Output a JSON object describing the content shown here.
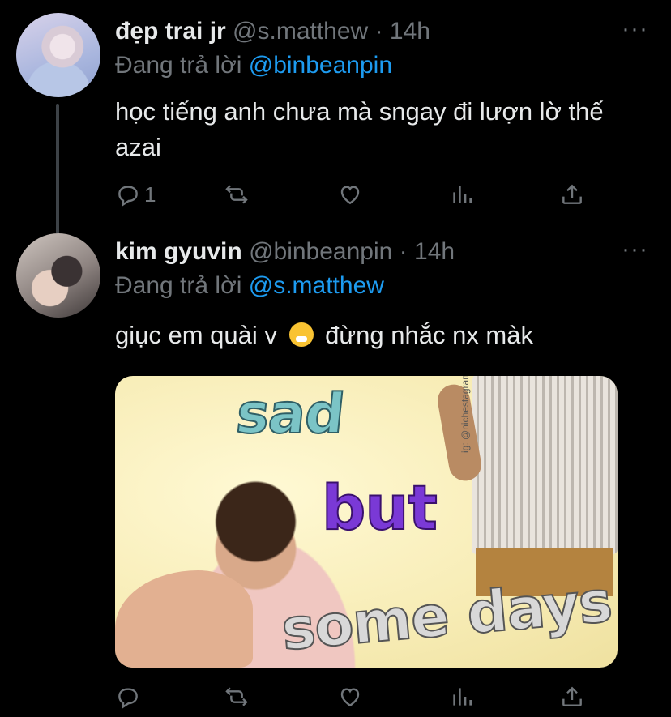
{
  "tweets": [
    {
      "name": "đẹp trai jr",
      "handle": "@s.matthew",
      "separator": "·",
      "time": "14h",
      "reply_prefix": "Đang trả lời",
      "reply_to": "@binbeanpin",
      "text": "học tiếng anh chưa mà sngay đi lượn lờ thế azai",
      "reply_count": "1",
      "more": "···"
    },
    {
      "name": "kim gyuvin",
      "handle": "@binbeanpin",
      "separator": "·",
      "time": "14h",
      "reply_prefix": "Đang trả lời",
      "reply_to": "@s.matthew",
      "text_before_emoji": "giục em quài v",
      "emoji": "face-with-steam-from-nose",
      "text_after_emoji": "đừng nhắc nx màk",
      "more": "···",
      "media": {
        "word1": "sad",
        "word2": "but",
        "word3": "some days",
        "credit": "ig: @nichestagram"
      }
    }
  ],
  "icons": [
    "reply-icon",
    "retweet-icon",
    "like-icon",
    "analytics-icon",
    "share-icon"
  ],
  "colors": {
    "background": "#000000",
    "text": "#e7e9ea",
    "muted": "#71767b",
    "link": "#1d9bf0"
  }
}
